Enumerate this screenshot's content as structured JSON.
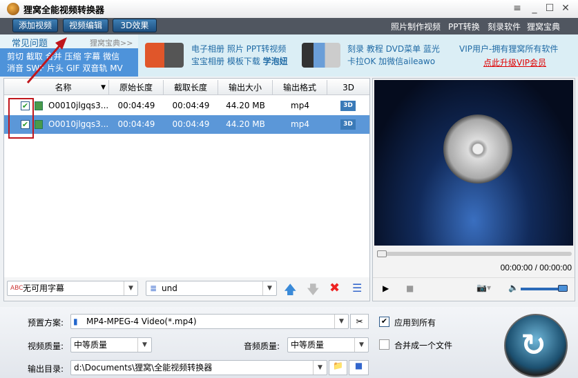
{
  "window": {
    "title": "狸窝全能视频转换器",
    "controls": [
      "menu",
      "minimize",
      "maximize",
      "close"
    ]
  },
  "toolbar": {
    "buttons": [
      "添加视频",
      "视频编辑",
      "3D效果"
    ],
    "links": [
      "照片制作视频",
      "PPT转换",
      "刻录软件",
      "狸窝宝典"
    ]
  },
  "ad": {
    "faq_title": "常见问题",
    "faq_more": "狸窝宝典>>",
    "faq_line1": "剪切 截取 合并 压缩 字幕 微信",
    "faq_line2": "消音 SWF 片头 GIF 双音轨 MV",
    "ppt_line1": "电子相册 照片 PPT转视频",
    "ppt_line2a": "宝宝相册 模板下载 ",
    "ppt_line2b": "学泡妞",
    "dvd_line1": "刻录 教程 DVD菜单 蓝光",
    "dvd_line2": "卡拉OK 加微信aileawo",
    "vip_line1": "VIP用户-拥有狸窝所有软件",
    "vip_link": "点此升级VIP会员"
  },
  "table": {
    "headers": [
      "名称",
      "原始长度",
      "截取长度",
      "输出大小",
      "输出格式",
      "3D"
    ],
    "rows": [
      {
        "name": "O0010jlgqs3...",
        "orig": "00:04:49",
        "clip": "00:04:49",
        "size": "44.20 MB",
        "fmt": "mp4",
        "checked": true,
        "selected": false
      },
      {
        "name": "O0010jlgqs3...",
        "orig": "00:04:49",
        "clip": "00:04:49",
        "size": "44.20 MB",
        "fmt": "mp4",
        "checked": true,
        "selected": true
      }
    ]
  },
  "listbar": {
    "subtitle": "无可用字幕",
    "audio": "und"
  },
  "player": {
    "time": "00:00:00 / 00:00:00",
    "progress": 0,
    "volume": 1.0
  },
  "settings": {
    "preset_label": "预置方案:",
    "preset": "MP4-MPEG-4 Video(*.mp4)",
    "apply_all": "应用到所有",
    "apply_all_checked": true,
    "vq_label": "视频质量:",
    "vq": "中等质量",
    "aq_label": "音频质量:",
    "aq": "中等质量",
    "merge": "合并成一个文件",
    "merge_checked": false,
    "out_label": "输出目录:",
    "out": "d:\\Documents\\狸窝\\全能视频转换器"
  },
  "colors": {
    "accent": "#5b97d8",
    "vip_link": "#e00000",
    "annotation": "#c0161c"
  }
}
